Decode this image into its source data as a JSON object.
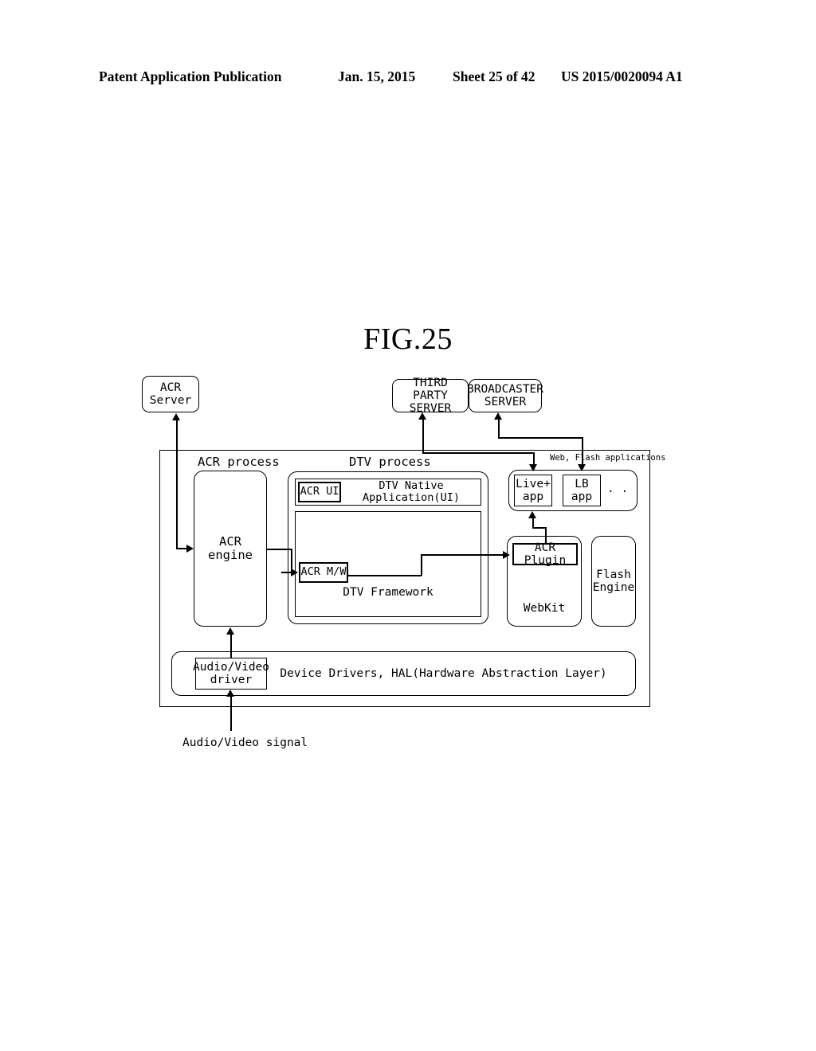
{
  "header": {
    "publication": "Patent Application Publication",
    "date": "Jan. 15, 2015",
    "sheet": "Sheet 25 of 42",
    "document_number": "US 2015/0020094 A1"
  },
  "figure": {
    "title": "FIG.25",
    "servers": {
      "acr_server": "ACR\nServer",
      "third_party_server": "THIRD PARTY\nSERVER",
      "broadcaster_server": "BROADCASTER\nSERVER"
    },
    "process_labels": {
      "acr_process": "ACR process",
      "dtv_process": "DTV process",
      "web_flash_applications": "Web, Flash applications"
    },
    "blocks": {
      "acr_engine": "ACR engine",
      "acr_ui": "ACR UI",
      "dtv_native_application": "DTV Native Application(UI)",
      "acr_mw": "ACR M/W",
      "dtv_framework": "DTV Framework",
      "live_plus_app": "Live+\napp",
      "lb_app": "LB\napp",
      "more_apps": ".  .",
      "acr_plugin": "ACR Plugin",
      "webkit": "WebKit",
      "flash_engine": "Flash\nEngine",
      "audio_video_driver": "Audio/Video\ndriver",
      "device_drivers": "Device Drivers, HAL(Hardware Abstraction Layer)"
    },
    "signals": {
      "audio_video_signal": "Audio/Video signal"
    }
  }
}
